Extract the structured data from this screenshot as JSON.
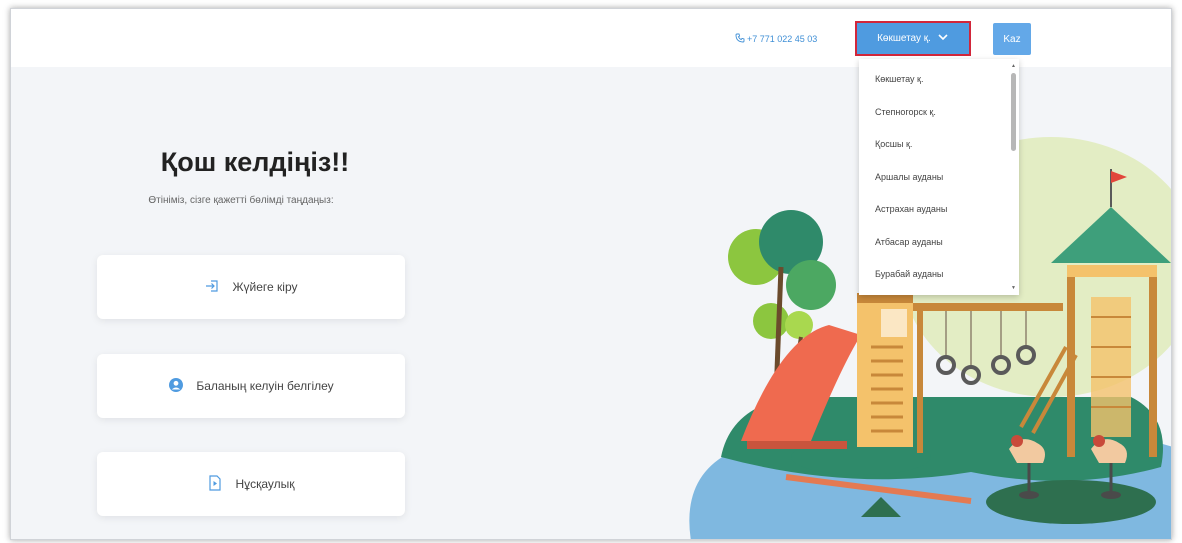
{
  "header": {
    "phone": "+7 771 022 45 03",
    "city_select_value": "Көкшетау қ.",
    "language_button": "Kaz"
  },
  "city_dropdown": {
    "options": [
      "Көкшетау қ.",
      "Степногорск қ.",
      "Қосшы қ.",
      "Аршалы ауданы",
      "Астрахан ауданы",
      "Атбасар ауданы",
      "Бурабай ауданы"
    ]
  },
  "main": {
    "title": "Қош келдіңіз!!",
    "subtitle": "Өтініміз, сізге қажетті бөлімді таңдаңыз:",
    "cards": [
      {
        "label": "Жүйеге кіру",
        "icon": "login-icon"
      },
      {
        "label": "Баланың келуін белгілеу",
        "icon": "user-circle-icon"
      },
      {
        "label": "Нұсқаулық",
        "icon": "document-icon"
      }
    ]
  },
  "colors": {
    "accent": "#4f9be0",
    "highlight_border": "#d2263a",
    "background": "#f3f5f8"
  }
}
